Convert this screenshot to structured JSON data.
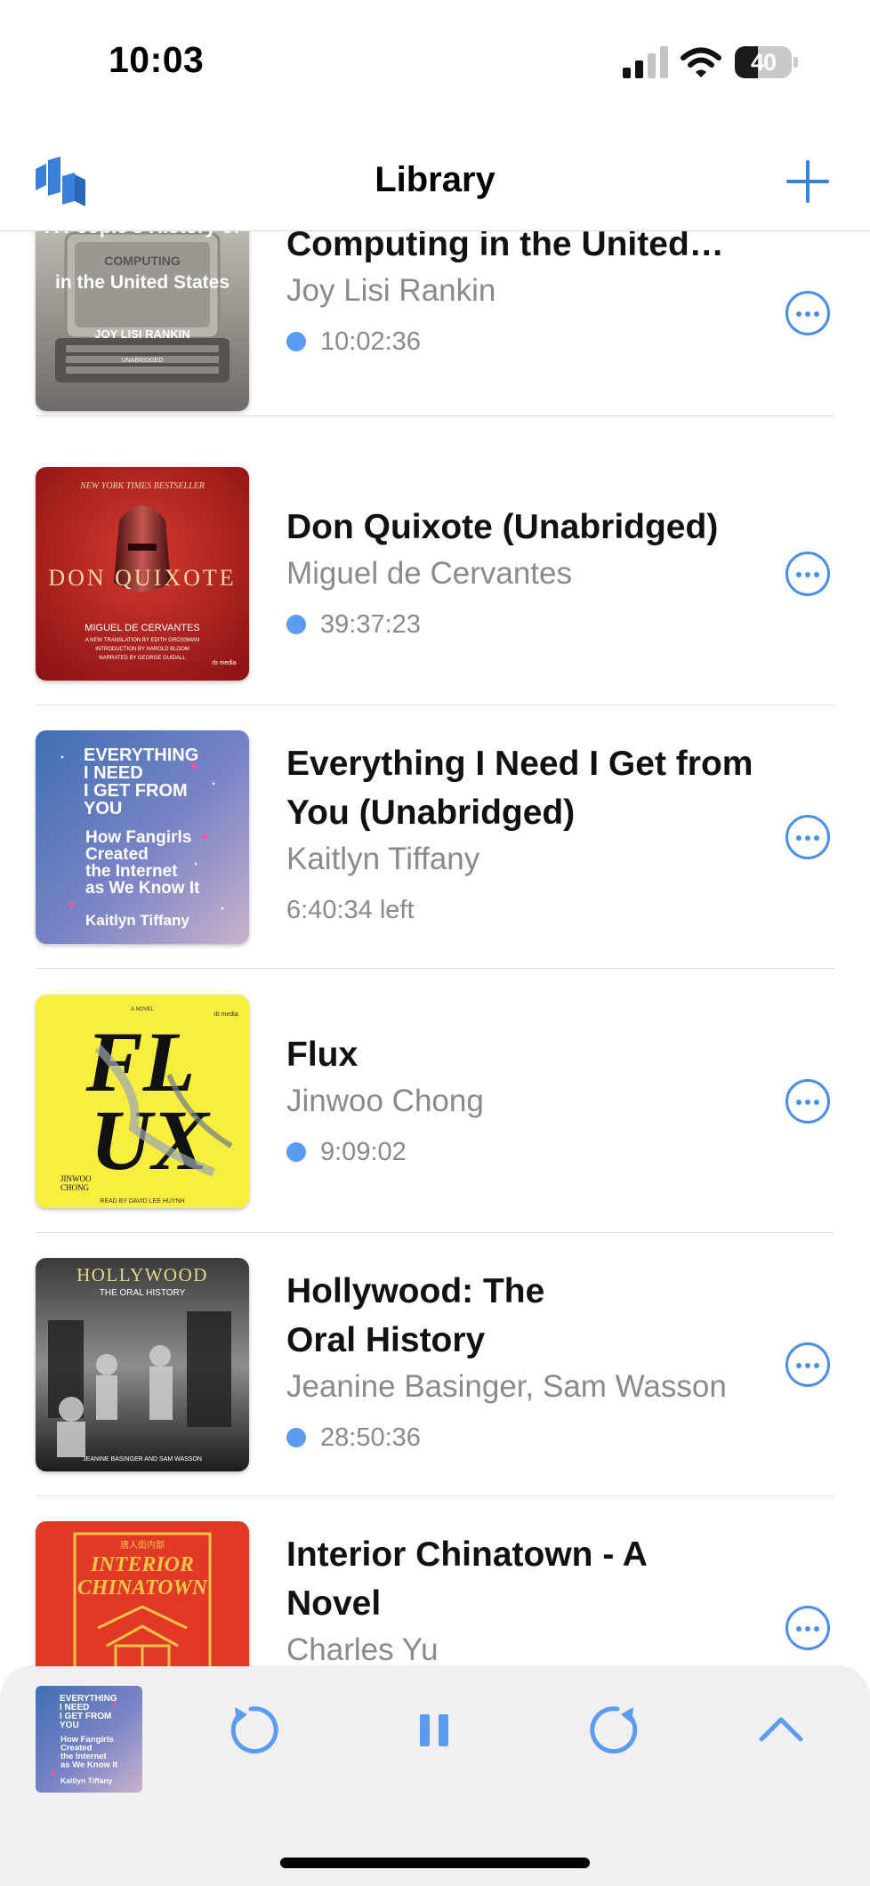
{
  "status_bar": {
    "time": "10:03",
    "battery": "40",
    "battery_level": 0.4
  },
  "nav": {
    "title": "Library"
  },
  "books": [
    {
      "title": "A People's History of Computing in the United…",
      "author": "Joy Lisi Rankin",
      "duration": "10:02:36",
      "unplayed": true,
      "cover": {
        "line1": "A People's History of",
        "line2": "COMPUTING",
        "line3": "in the United States",
        "author": "JOY LISI RANKIN",
        "badge": "UNABRIDGED"
      }
    },
    {
      "title": "Don Quixote (Unabridged)",
      "author": "Miguel de Cervantes",
      "duration": "39:37:23",
      "unplayed": true,
      "cover": {
        "top": "NEW YORK TIMES BESTSELLER",
        "name": "DON QUIXOTE",
        "author": "MIGUEL DE CERVANTES",
        "line1": "A NEW TRANSLATION BY EDITH GROSSMAN",
        "line2": "INTRODUCTION BY HAROLD BLOOM",
        "line3": "NARRATED BY GEORGE GUIDALL",
        "publisher": "rb media"
      }
    },
    {
      "title": "Everything I Need I Get from You (Unabridged)",
      "author": "Kaitlyn Tiffany",
      "duration": "6:40:34 left",
      "unplayed": false,
      "cover": {
        "l1": "EVERYTHING",
        "l2": "I NEED",
        "l3": "I GET FROM",
        "l4": "YOU",
        "s1": "How Fangirls",
        "s2": "Created",
        "s3": "the Internet",
        "s4": "as We Know It",
        "author": "Kaitlyn Tiffany"
      }
    },
    {
      "title": "Flux",
      "author": "Jinwoo Chong",
      "duration": "9:09:02",
      "unplayed": true,
      "cover": {
        "tag": "A NOVEL",
        "a": "FL",
        "b": "UX",
        "author1": "JINWOO",
        "author2": "CHONG",
        "reader": "READ BY DAVID LEE HUYNH",
        "publisher": "rb media"
      }
    },
    {
      "title": "Hollywood: The Oral History",
      "author": "Jeanine Basinger, Sam Wasson",
      "duration": "28:50:36",
      "unplayed": true,
      "cover": {
        "title": "HOLLYWOOD",
        "sub": "THE ORAL HISTORY",
        "authors": "JEANINE BASINGER AND SAM WASSON"
      }
    },
    {
      "title": "Interior Chinatown - A Novel",
      "author": "Charles Yu",
      "duration": "",
      "unplayed": false,
      "cover": {
        "l1": "INTERIOR",
        "l2": "CHINATOWN",
        "cjk": "唐人街内部"
      }
    }
  ],
  "player": {
    "cover": {
      "l1": "EVERYTHING",
      "l2": "I NEED",
      "l3": "I GET FROM",
      "l4": "YOU",
      "s1": "How Fangirls",
      "s2": "Created",
      "s3": "the Internet",
      "s4": "as We Know It",
      "author": "Kaitlyn Tiffany"
    }
  }
}
